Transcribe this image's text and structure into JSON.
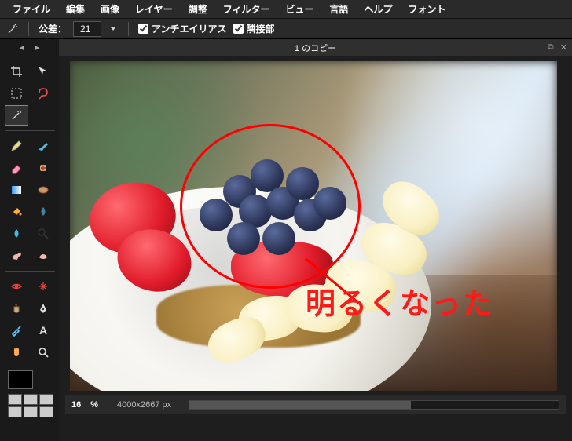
{
  "menu": {
    "items": [
      "ファイル",
      "編集",
      "画像",
      "レイヤー",
      "調整",
      "フィルター",
      "ビュー",
      "言語",
      "ヘルプ",
      "フォント"
    ]
  },
  "options": {
    "tolerance_label": "公差：",
    "tolerance_value": "21",
    "antialias_label": "アンチエイリアス",
    "contiguous_label": "隣接部"
  },
  "title": "1 のコピー",
  "annotation": {
    "text": "明るくなった"
  },
  "status": {
    "zoom": "16",
    "pct": "%",
    "dims": "4000x2667 px"
  },
  "tools": {
    "left": [
      "crop",
      "marquee",
      "wand",
      "pencil",
      "eraser",
      "gradient",
      "bucket",
      "droplet",
      "smudge",
      "eye",
      "clone",
      "brush-a",
      "text",
      "hand"
    ],
    "right": [
      "move",
      "lasso",
      "",
      "brush",
      "healing",
      "sponge",
      "blur",
      "dodge",
      "burn",
      "redeye",
      "pen",
      "eyedropper",
      "",
      "zoom"
    ]
  }
}
